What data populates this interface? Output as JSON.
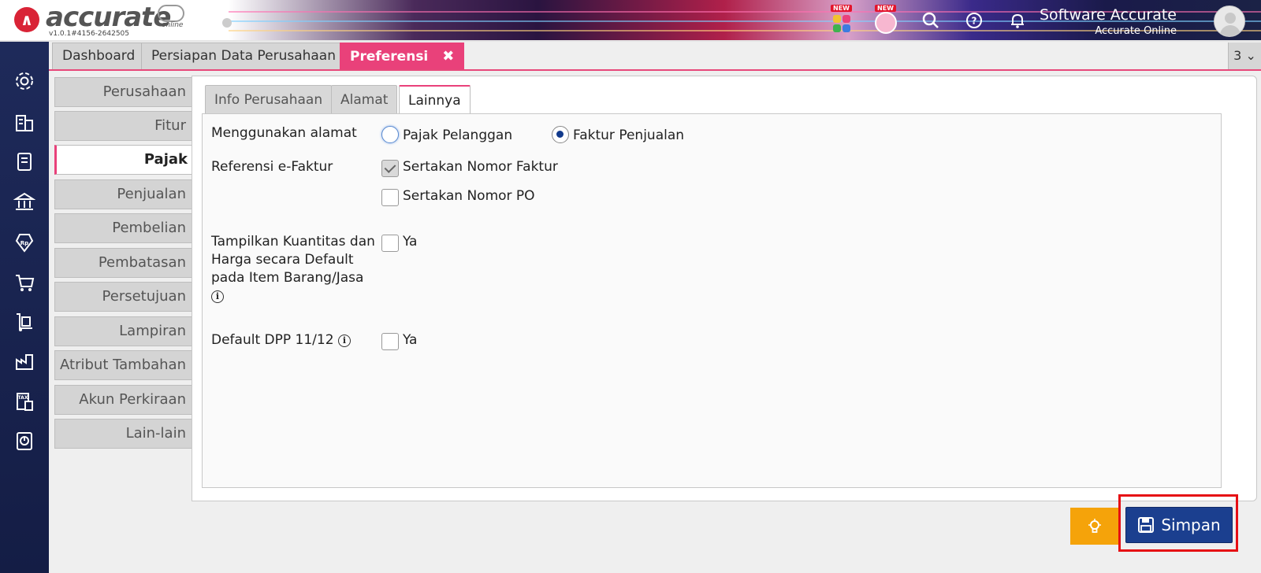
{
  "app": {
    "logo_text": "accurate",
    "logo_sub": "online",
    "version": "v1.0.1#4156-2642505",
    "new_badge": "NEW",
    "user_name": "Software Accurate",
    "user_sub": "Accurate Online"
  },
  "tabs": [
    {
      "label": "Dashboard"
    },
    {
      "label": "Persiapan Data Perusahaan"
    },
    {
      "label": "Preferensi"
    }
  ],
  "tab_count": "3",
  "categories": [
    "Perusahaan",
    "Fitur",
    "Pajak",
    "Penjualan",
    "Pembelian",
    "Pembatasan",
    "Persetujuan",
    "Lampiran",
    "Atribut Tambahan",
    "Akun Perkiraan",
    "Lain-lain"
  ],
  "active_category": "Pajak",
  "subtabs": [
    "Info Perusahaan",
    "Alamat",
    "Lainnya"
  ],
  "active_subtab": "Lainnya",
  "form": {
    "address_label": "Menggunakan alamat",
    "radio_customer": "Pajak Pelanggan",
    "radio_invoice": "Faktur Penjualan",
    "selected_radio": "Faktur Penjualan",
    "efaktur_label": "Referensi e-Faktur",
    "chk_faktur": "Sertakan Nomor Faktur",
    "chk_faktur_checked": true,
    "chk_po": "Sertakan Nomor PO",
    "chk_po_checked": false,
    "qty_label_1": "Tampilkan Kuantitas dan",
    "qty_label_2": "Harga secara Default",
    "qty_label_3": "pada Item Barang/Jasa",
    "qty_yes": "Ya",
    "dpp_label": "Default DPP 11/12",
    "dpp_yes": "Ya",
    "info_glyph": "i"
  },
  "buttons": {
    "save": "Simpan"
  },
  "colors": {
    "accent_pink": "#e9417a",
    "sidebar_navy": "#1e2a5a",
    "save_blue": "#1b3f8f",
    "hint_orange": "#f5a30a",
    "highlight_red": "#e60f14"
  }
}
